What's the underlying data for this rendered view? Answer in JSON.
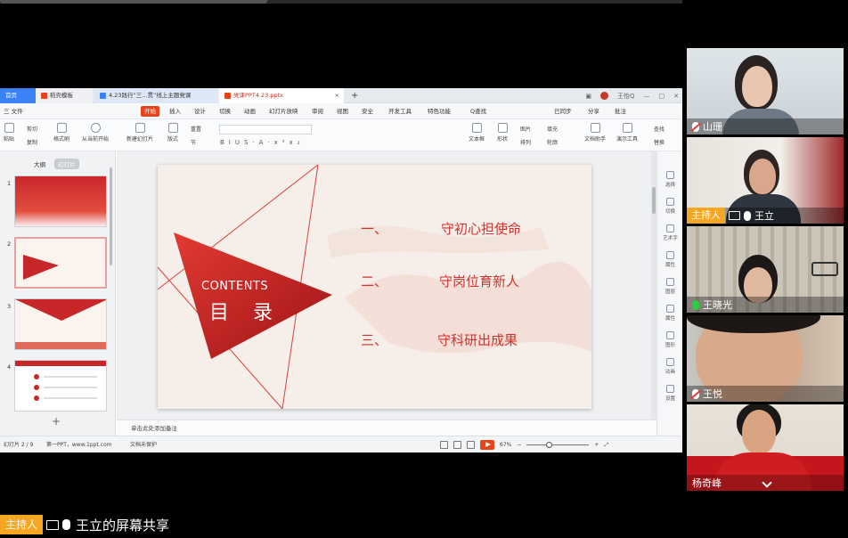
{
  "app": {
    "tabs": [
      {
        "label": "首页",
        "color": "#3b82f6"
      },
      {
        "label": "稻壳模板",
        "color": "#e8431a"
      },
      {
        "label": "4.23践行“三...贯”线上主题党课",
        "color": "#3b82f6"
      },
      {
        "label": "党课PPT4.23.pptx",
        "color": "#e8431a"
      }
    ],
    "user_name": "王怡Q",
    "menu": [
      "三 文件",
      "开始",
      "插入",
      "设计",
      "切换",
      "动画",
      "幻灯片放映",
      "审阅",
      "视图",
      "安全",
      "开发工具",
      "特色功能",
      "Q查找",
      "已同步",
      "分享",
      "批注"
    ],
    "ribbon": {
      "paste": "粘贴",
      "cut": "剪切",
      "copy": "复制",
      "format_painter": "格式刷",
      "from_current": "从当前开始",
      "new_slide": "新建幻灯片",
      "layout": "版式",
      "section": "节",
      "reset": "重置",
      "textbox": "文本框",
      "shape": "形状",
      "arrange": "排列",
      "image": "图片",
      "fill": "填充",
      "outline": "轮廓",
      "doc_helper": "文档助手",
      "presentation_tools": "演示工具",
      "find": "查找",
      "replace": "替换"
    },
    "thumbs": {
      "tab_outline": "大纲",
      "tab_slides": "幻灯片",
      "numbers": [
        "1",
        "2",
        "3",
        "4"
      ]
    },
    "slide": {
      "contents_en": "CONTENTS",
      "contents_cn": "目 录",
      "items": [
        {
          "num": "一、",
          "text": "守初心担使命"
        },
        {
          "num": "二、",
          "text": "守岗位育新人"
        },
        {
          "num": "三、",
          "text": "守科研出成果"
        }
      ]
    },
    "side_panel": [
      "选择",
      "切换",
      "艺术字",
      "属性",
      "图层",
      "属性",
      "图形",
      "动画",
      "设置"
    ],
    "notes_placeholder": "单击此处添加备注",
    "status": {
      "slide_count": "幻灯片 2 / 9",
      "theme": "第一PPT，www.1ppt.com",
      "protect": "文档未保护",
      "zoom": "67%"
    }
  },
  "participants": [
    {
      "name": "山珊",
      "host": false,
      "mic": "muted"
    },
    {
      "name": "王立",
      "host": true,
      "mic": "on"
    },
    {
      "name": "王晓光",
      "host": false,
      "mic": "on"
    },
    {
      "name": "王悦",
      "host": false,
      "mic": "muted"
    },
    {
      "name": "杨奇峰",
      "host": false,
      "mic": "none"
    }
  ],
  "host_label": "主持人",
  "banner_text": "王立的屏幕共享"
}
